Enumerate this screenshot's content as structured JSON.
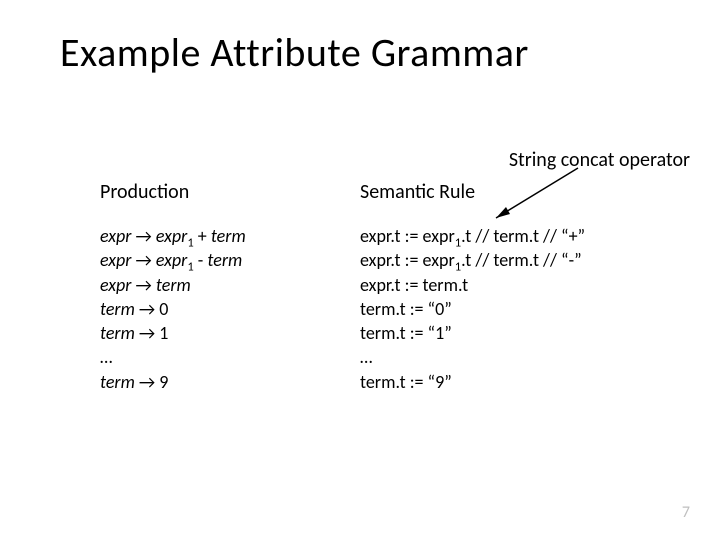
{
  "slide": {
    "title": "Example Attribute Grammar",
    "annotation": "String concat operator",
    "page_number": "7",
    "headers": {
      "production": "Production",
      "semantic_rule": "Semantic Rule"
    },
    "productions": [
      {
        "lhs": "expr",
        "arrow": " → ",
        "rhs_a": "expr",
        "sub_a": "1",
        "mid": " + ",
        "rhs_b": "term"
      },
      {
        "lhs": "expr",
        "arrow": " → ",
        "rhs_a": "expr",
        "sub_a": "1",
        "mid": " - ",
        "rhs_b": "term"
      },
      {
        "lhs": "expr",
        "arrow": " → ",
        "rhs_a": "term",
        "sub_a": "",
        "mid": "",
        "rhs_b": ""
      },
      {
        "lhs": "term",
        "arrow": " → ",
        "rhs_a": "0",
        "sub_a": "",
        "mid": "",
        "rhs_b": ""
      },
      {
        "lhs": "term",
        "arrow": " → ",
        "rhs_a": "1",
        "sub_a": "",
        "mid": "",
        "rhs_b": ""
      },
      {
        "lhs": "…",
        "arrow": "",
        "rhs_a": "",
        "sub_a": "",
        "mid": "",
        "rhs_b": ""
      },
      {
        "lhs": "term",
        "arrow": " → ",
        "rhs_a": "9",
        "sub_a": "",
        "mid": "",
        "rhs_b": ""
      }
    ],
    "semantic_rules": [
      {
        "pre": "expr.t := expr",
        "sub": "1",
        "post": ".t // term.t // “+”"
      },
      {
        "pre": "expr.t := expr",
        "sub": "1",
        "post": ".t // term.t // “-”"
      },
      {
        "pre": "expr.t := term.t",
        "sub": "",
        "post": ""
      },
      {
        "pre": "term.t := “0”",
        "sub": "",
        "post": ""
      },
      {
        "pre": "term.t := “1”",
        "sub": "",
        "post": ""
      },
      {
        "pre": "…",
        "sub": "",
        "post": ""
      },
      {
        "pre": "term.t := “9”",
        "sub": "",
        "post": ""
      }
    ]
  }
}
